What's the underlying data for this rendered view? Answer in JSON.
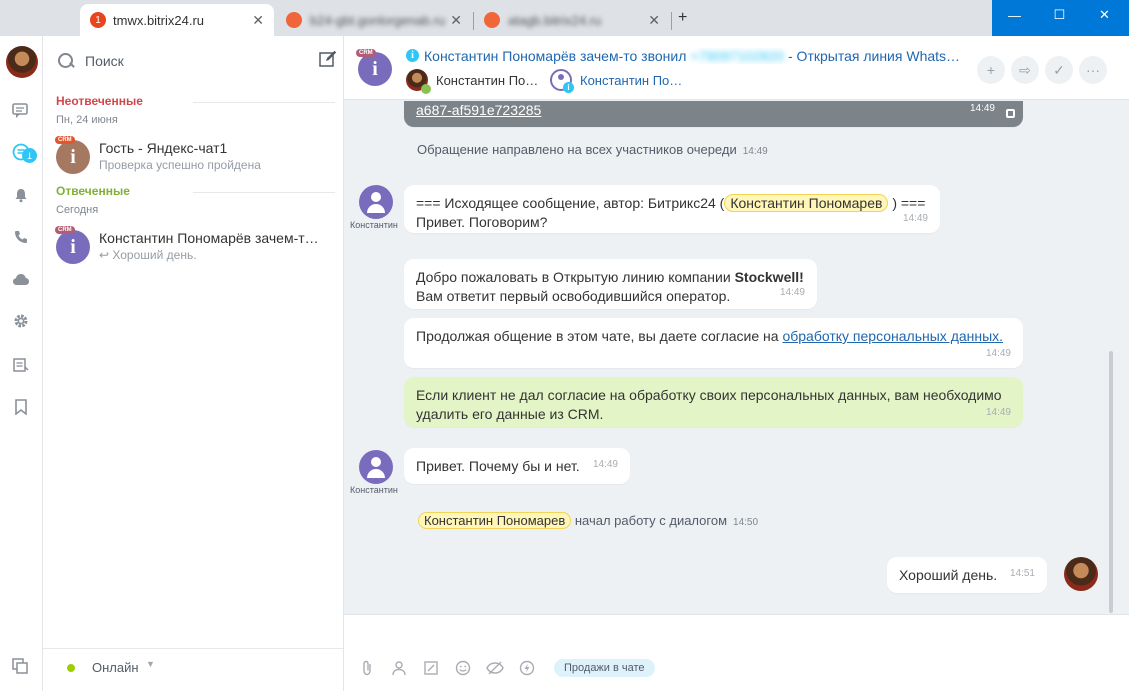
{
  "browser": {
    "tabs": [
      {
        "title": "tmwx.bitrix24.ru",
        "badge": "1",
        "active": true
      },
      {
        "title": "b24-gbt.gonlorgenab.ru",
        "blurred": true
      },
      {
        "title": "atagb.bitrix24.ru",
        "blurred": true
      }
    ],
    "new_tab_label": "+",
    "close_label": "✕",
    "window": {
      "minimize": "—",
      "maximize": "☐",
      "close": "✕"
    }
  },
  "rail": {
    "messages_badge": "1"
  },
  "recent": {
    "search_placeholder": "Поиск",
    "groups": [
      {
        "title": "Неотвеченные",
        "date": "Пн, 24 июня",
        "items": [
          {
            "crm": "CRM",
            "avatar_letter": "i",
            "title": "Гость - Яндекс-чат1",
            "subtitle": "Проверка успешно пройдена",
            "avatar_color": "#a57862"
          }
        ]
      },
      {
        "title": "Отвеченные",
        "date": "Сегодня",
        "items": [
          {
            "crm": "CRM",
            "avatar_letter": "i",
            "title": "Константин Пономарёв зачем-т…",
            "subtitle": "↩ Хороший день.",
            "avatar_color": "#7a6cbc"
          }
        ]
      }
    ],
    "status_label": "Онлайн"
  },
  "chat": {
    "header": {
      "crm": "CRM",
      "avatar_letter": "i",
      "info_glyph": "i",
      "title_prefix": "Константин Пономарёв зачем-то звонил",
      "title_blurred": "+79097102820",
      "title_suffix": "- Открытая линия Whats…",
      "members": [
        {
          "name": "Константин По…",
          "kind": "photo"
        },
        {
          "name": "Константин По…",
          "kind": "generic"
        }
      ],
      "actions": [
        "+",
        "⇨",
        "✓",
        "···"
      ]
    },
    "messages": {
      "system_link": {
        "text": "a687-af591e723285",
        "time": "14:49"
      },
      "queue_notice": {
        "text": "Обращение направлено на всех участников очереди",
        "time": "14:49"
      },
      "outgoing_header": {
        "author": "Константин",
        "prefix": "=== Исходящее сообщение, автор: Битрикс24 (",
        "mention": "Константин Пономарев",
        "suffix": ") ===",
        "line2": "Привет. Поговорим?",
        "time": "14:49"
      },
      "welcome": {
        "line1_prefix": "Добро пожаловать в Открытую линию компании ",
        "company": "Stockwell!",
        "line2": "Вам ответит первый освободившийся оператор.",
        "time": "14:49"
      },
      "consent": {
        "prefix": "Продолжая общение в этом чате, вы даете согласие на ",
        "link": "обработку персональных данных.",
        "time": "14:49"
      },
      "green_notice": {
        "line1": "Если клиент не дал согласие на обработку своих персональных данных, вам необходимо",
        "line2": "удалить его данные из CRM.",
        "time": "14:49"
      },
      "client_reply": {
        "author": "Константин",
        "text": "Привет. Почему бы и нет.",
        "time": "14:49"
      },
      "started_work": {
        "mention": "Константин Пономарев",
        "text": "начал работу с диалогом",
        "time": "14:50"
      },
      "my_reply": {
        "text": "Хороший день.",
        "time": "14:51"
      }
    },
    "input": {
      "placeholder": "",
      "sales_chip": "Продажи в чате"
    }
  },
  "colors": {
    "accent": "#2fc6f6",
    "link": "#2067b0",
    "unanswered": "#d0484f",
    "answered": "#7fb137",
    "window_bar": "#0078d7"
  }
}
